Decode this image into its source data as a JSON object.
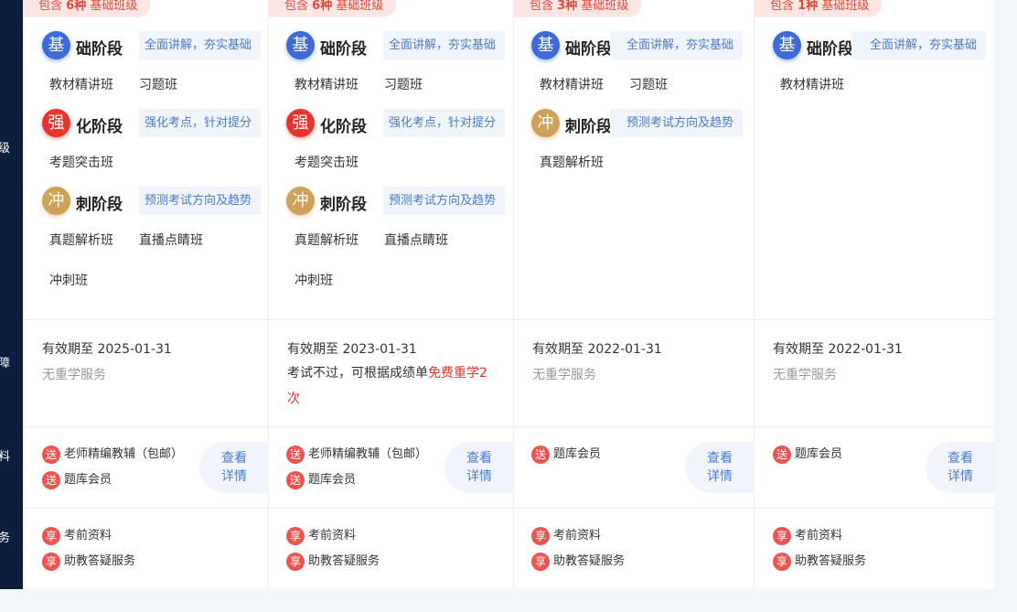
{
  "sidebar": [
    "含级",
    "务障",
    "送料",
    "套务"
  ],
  "columns": [
    {
      "tag_prefix": "包含",
      "tag_count": "6种",
      "tag_suffix": "基础班级",
      "stage1": {
        "badge": "基",
        "name": "础阶段",
        "desc": "全面讲解，夯实基础",
        "classes": [
          "教材精讲班",
          "习题班"
        ]
      },
      "stage2": {
        "badge": "强",
        "name": "化阶段",
        "desc": "强化考点，针对提分",
        "classes": [
          "考题突击班"
        ]
      },
      "stage3": {
        "badge": "冲",
        "name": "刺阶段",
        "desc": "预测考试方向及趋势",
        "classes": [
          "真题解析班",
          "直播点睛班",
          "冲刺班"
        ]
      },
      "validity": "有效期至 2025-01-31",
      "relearn": "无重学服务",
      "gifts": [
        {
          "icon": "送",
          "label": "老师精编教辅（包邮）"
        },
        {
          "icon": "送",
          "label": "题库会员"
        }
      ],
      "detail": [
        "查看",
        "详情"
      ],
      "services": [
        {
          "icon": "享",
          "label": "考前资料"
        },
        {
          "icon": "享",
          "label": "助教答疑服务"
        }
      ]
    },
    {
      "tag_prefix": "包含",
      "tag_count": "6种",
      "tag_suffix": "基础班级",
      "stage1": {
        "badge": "基",
        "name": "础阶段",
        "desc": "全面讲解，夯实基础",
        "classes": [
          "教材精讲班",
          "习题班"
        ]
      },
      "stage2": {
        "badge": "强",
        "name": "化阶段",
        "desc": "强化考点，针对提分",
        "classes": [
          "考题突击班"
        ]
      },
      "stage3": {
        "badge": "冲",
        "name": "刺阶段",
        "desc": "预测考试方向及趋势",
        "classes": [
          "真题解析班",
          "直播点睛班",
          "冲刺班"
        ]
      },
      "validity": "有效期至 2023-01-31",
      "relearn_text": "考试不过，可根据成绩单",
      "relearn_highlight": "免费重学2次",
      "gifts": [
        {
          "icon": "送",
          "label": "老师精编教辅（包邮）"
        },
        {
          "icon": "送",
          "label": "题库会员"
        }
      ],
      "detail": [
        "查看",
        "详情"
      ],
      "services": [
        {
          "icon": "享",
          "label": "考前资料"
        },
        {
          "icon": "享",
          "label": "助教答疑服务"
        }
      ]
    },
    {
      "tag_prefix": "包含",
      "tag_count": "3种",
      "tag_suffix": "基础班级",
      "stage1": {
        "badge": "基",
        "name": "础阶段",
        "desc": "全面讲解，夯实基础",
        "classes": [
          "教材精讲班",
          "习题班"
        ]
      },
      "stage3": {
        "badge": "冲",
        "name": "刺阶段",
        "desc": "预测考试方向及趋势",
        "classes": [
          "真题解析班"
        ]
      },
      "validity": "有效期至 2022-01-31",
      "relearn": "无重学服务",
      "gifts": [
        {
          "icon": "送",
          "label": "题库会员"
        }
      ],
      "detail": [
        "查看",
        "详情"
      ],
      "services": [
        {
          "icon": "享",
          "label": "考前资料"
        },
        {
          "icon": "享",
          "label": "助教答疑服务"
        }
      ]
    },
    {
      "tag_prefix": "包含",
      "tag_count": "1种",
      "tag_suffix": "基础班级",
      "stage1": {
        "badge": "基",
        "name": "础阶段",
        "desc": "全面讲解，夯实基础",
        "classes": [
          "教材精讲班"
        ]
      },
      "validity": "有效期至 2022-01-31",
      "relearn": "无重学服务",
      "gifts": [
        {
          "icon": "送",
          "label": "题库会员"
        }
      ],
      "detail": [
        "查看",
        "详情"
      ],
      "services": [
        {
          "icon": "享",
          "label": "考前资料"
        },
        {
          "icon": "享",
          "label": "助教答疑服务"
        }
      ]
    }
  ]
}
